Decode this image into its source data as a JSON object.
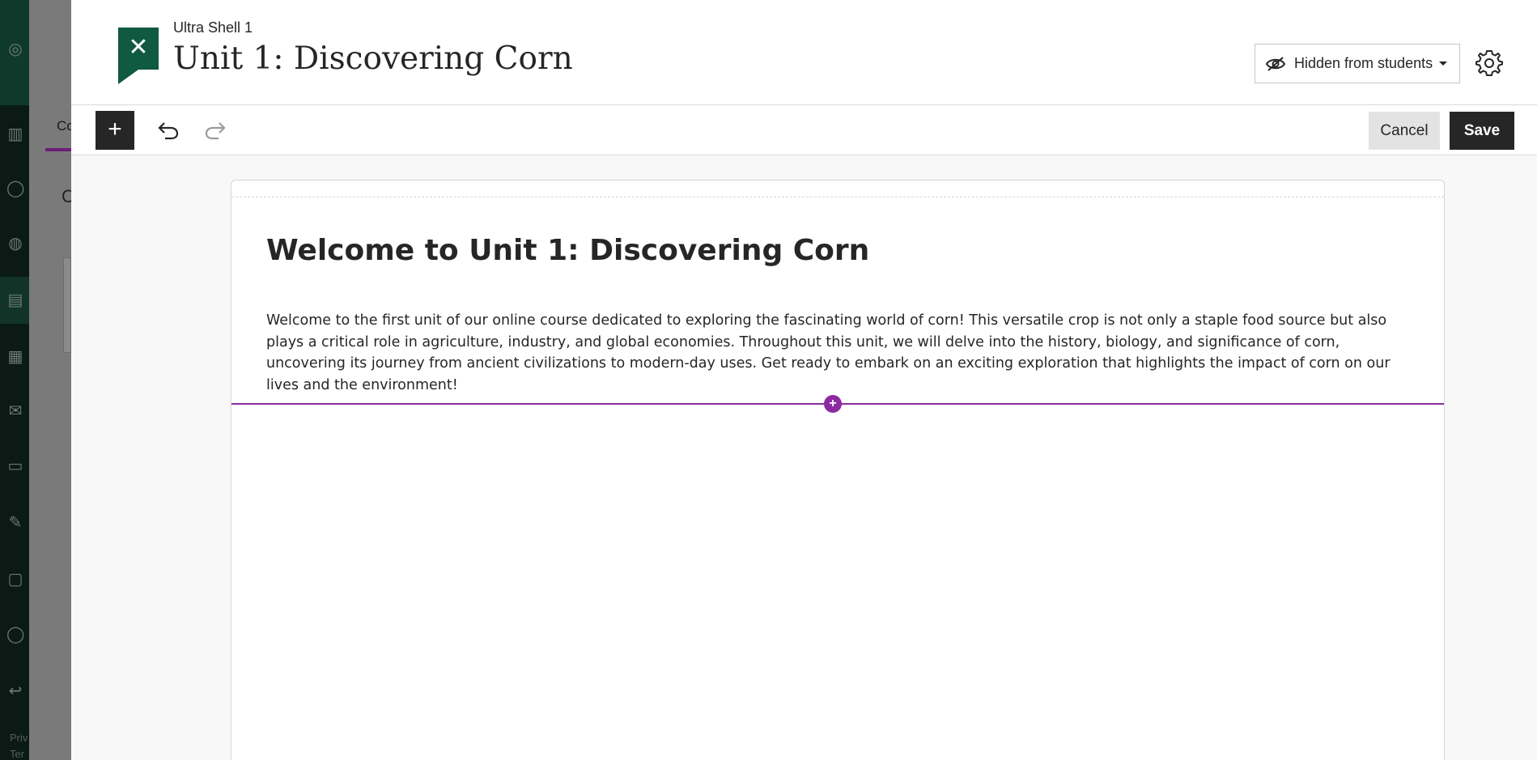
{
  "background_app": {
    "tab_label": "Co",
    "heading": "C",
    "footer": [
      "Priv",
      "Ter"
    ]
  },
  "panel": {
    "course_name": "Ultra Shell 1",
    "title": "Unit 1: Discovering Corn",
    "visibility_label": "Hidden from students",
    "close_label": "✕",
    "add_label": "+",
    "cancel_label": "Cancel",
    "save_label": "Save"
  },
  "document": {
    "heading": "Welcome to Unit 1: Discovering Corn",
    "body": "Welcome to the first unit of our online course dedicated to exploring the fascinating world of corn! This versatile crop is not only a staple food source but also plays a critical role in agriculture, industry, and global economies. Throughout this unit, we will delve into the history, biology, and significance of corn, uncovering its journey from ancient civilizations to modern-day uses. Get ready to embark on an exciting exploration that highlights the impact of corn on our lives and the environment!",
    "insert_label": "+"
  },
  "colors": {
    "close_green": "#0f5a40",
    "accent_purple": "#8c2ba0",
    "dark_button": "#262626"
  },
  "icons": [
    "close-icon",
    "eye-slash-icon",
    "caret-down-icon",
    "gear-icon",
    "plus-icon",
    "undo-icon",
    "redo-icon",
    "help-icon"
  ]
}
